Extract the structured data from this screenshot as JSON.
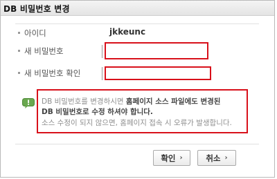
{
  "dialog": {
    "title": "DB 비밀번호 변경"
  },
  "form": {
    "id_label": "아이디",
    "id_value": "jkkeunc",
    "new_pw_label": "새 비밀번호",
    "new_pw_value": "",
    "confirm_pw_label": "새 비밀번호 확인",
    "confirm_pw_value": ""
  },
  "notice": {
    "icon": "speech-bubble-exclamation-icon",
    "line1_plain": "DB 비밀번호를 변경하시면 ",
    "line1_bold": "홈페이지 소스 파일에도 변경된",
    "line2_bold": "DB 비밀번호로 수정 하셔야 합니다.",
    "line3": "소스 수정이 되지 않으면, 홈페이지 접속 시 오류가 발생합니다."
  },
  "buttons": {
    "confirm_label": "확인",
    "cancel_label": "취소",
    "chevron_icon": "chevron-right-icon"
  },
  "colors": {
    "highlight": "#d8101a",
    "notice_icon": "#6aa84f"
  }
}
